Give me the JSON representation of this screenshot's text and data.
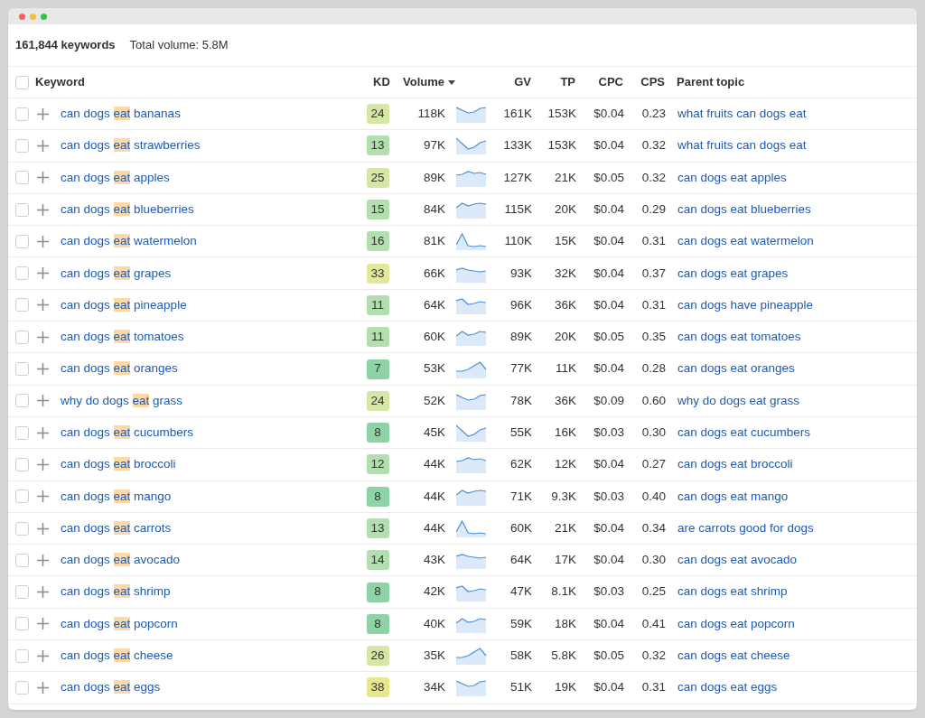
{
  "summary": {
    "count": "161,844 keywords",
    "total": "Total volume: 5.8M"
  },
  "select_all": {
    "checked": false
  },
  "columns": [
    {
      "label": "Keyword",
      "sorted": false
    },
    {
      "label": "KD",
      "sorted": false
    },
    {
      "label": "Volume",
      "sorted": true
    },
    {
      "label": "GV",
      "sorted": false
    },
    {
      "label": "TP",
      "sorted": false
    },
    {
      "label": "CPC",
      "sorted": false
    },
    {
      "label": "CPS",
      "sorted": false
    },
    {
      "label": "Parent topic",
      "sorted": false
    }
  ],
  "rows": [
    {
      "checked": false,
      "keyword": {
        "before": "can dogs ",
        "highlight": "eat",
        "after": " bananas"
      },
      "kd": "24",
      "color": "#d6e6a6",
      "volume": "118K",
      "gv": "161K",
      "tp": "153K",
      "cpc": "$0.04",
      "cps": "0.23",
      "parent": "what fruits can dogs eat"
    },
    {
      "checked": false,
      "keyword": {
        "before": "can dogs ",
        "highlight": "eat",
        "after": " strawberries"
      },
      "kd": "13",
      "color": "#b3dfb0",
      "volume": "97K",
      "gv": "133K",
      "tp": "153K",
      "cpc": "$0.04",
      "cps": "0.32",
      "parent": "what fruits can dogs eat"
    },
    {
      "checked": false,
      "keyword": {
        "before": "can dogs ",
        "highlight": "eat",
        "after": " apples"
      },
      "kd": "25",
      "color": "#d6e6a6",
      "volume": "89K",
      "gv": "127K",
      "tp": "21K",
      "cpc": "$0.05",
      "cps": "0.32",
      "parent": "can dogs eat apples"
    },
    {
      "checked": false,
      "keyword": {
        "before": "can dogs ",
        "highlight": "eat",
        "after": " blueberries"
      },
      "kd": "15",
      "color": "#b3dfb0",
      "volume": "84K",
      "gv": "115K",
      "tp": "20K",
      "cpc": "$0.04",
      "cps": "0.29",
      "parent": "can dogs eat blueberries"
    },
    {
      "checked": false,
      "keyword": {
        "before": "can dogs ",
        "highlight": "eat",
        "after": " watermelon"
      },
      "kd": "16",
      "color": "#b3dfb0",
      "volume": "81K",
      "gv": "110K",
      "tp": "15K",
      "cpc": "$0.04",
      "cps": "0.31",
      "parent": "can dogs eat watermelon"
    },
    {
      "checked": false,
      "keyword": {
        "before": "can dogs ",
        "highlight": "eat",
        "after": " grapes"
      },
      "kd": "33",
      "color": "#e3e89c",
      "volume": "66K",
      "gv": "93K",
      "tp": "32K",
      "cpc": "$0.04",
      "cps": "0.37",
      "parent": "can dogs eat grapes"
    },
    {
      "checked": false,
      "keyword": {
        "before": "can dogs ",
        "highlight": "eat",
        "after": " pineapple"
      },
      "kd": "11",
      "color": "#b3dfb0",
      "volume": "64K",
      "gv": "96K",
      "tp": "36K",
      "cpc": "$0.04",
      "cps": "0.31",
      "parent": "can dogs have pineapple"
    },
    {
      "checked": false,
      "keyword": {
        "before": "can dogs ",
        "highlight": "eat",
        "after": " tomatoes"
      },
      "kd": "11",
      "color": "#b3dfb0",
      "volume": "60K",
      "gv": "89K",
      "tp": "20K",
      "cpc": "$0.05",
      "cps": "0.35",
      "parent": "can dogs eat tomatoes"
    },
    {
      "checked": false,
      "keyword": {
        "before": "can dogs ",
        "highlight": "eat",
        "after": " oranges"
      },
      "kd": "7",
      "color": "#8ed3a6",
      "volume": "53K",
      "gv": "77K",
      "tp": "11K",
      "cpc": "$0.04",
      "cps": "0.28",
      "parent": "can dogs eat oranges"
    },
    {
      "checked": false,
      "keyword": {
        "before": "why do dogs ",
        "highlight": "eat",
        "after": " grass"
      },
      "kd": "24",
      "color": "#d6e6a6",
      "volume": "52K",
      "gv": "78K",
      "tp": "36K",
      "cpc": "$0.09",
      "cps": "0.60",
      "parent": "why do dogs eat grass"
    },
    {
      "checked": false,
      "keyword": {
        "before": "can dogs ",
        "highlight": "eat",
        "after": " cucumbers"
      },
      "kd": "8",
      "color": "#8ed3a6",
      "volume": "45K",
      "gv": "55K",
      "tp": "16K",
      "cpc": "$0.03",
      "cps": "0.30",
      "parent": "can dogs eat cucumbers"
    },
    {
      "checked": false,
      "keyword": {
        "before": "can dogs ",
        "highlight": "eat",
        "after": " broccoli"
      },
      "kd": "12",
      "color": "#b3dfb0",
      "volume": "44K",
      "gv": "62K",
      "tp": "12K",
      "cpc": "$0.04",
      "cps": "0.27",
      "parent": "can dogs eat broccoli"
    },
    {
      "checked": false,
      "keyword": {
        "before": "can dogs ",
        "highlight": "eat",
        "after": " mango"
      },
      "kd": "8",
      "color": "#8ed3a6",
      "volume": "44K",
      "gv": "71K",
      "tp": "9.3K",
      "cpc": "$0.03",
      "cps": "0.40",
      "parent": "can dogs eat mango"
    },
    {
      "checked": false,
      "keyword": {
        "before": "can dogs ",
        "highlight": "eat",
        "after": " carrots"
      },
      "kd": "13",
      "color": "#b3dfb0",
      "volume": "44K",
      "gv": "60K",
      "tp": "21K",
      "cpc": "$0.04",
      "cps": "0.34",
      "parent": "are carrots good for dogs"
    },
    {
      "checked": false,
      "keyword": {
        "before": "can dogs ",
        "highlight": "eat",
        "after": " avocado"
      },
      "kd": "14",
      "color": "#b3dfb0",
      "volume": "43K",
      "gv": "64K",
      "tp": "17K",
      "cpc": "$0.04",
      "cps": "0.30",
      "parent": "can dogs eat avocado"
    },
    {
      "checked": false,
      "keyword": {
        "before": "can dogs ",
        "highlight": "eat",
        "after": " shrimp"
      },
      "kd": "8",
      "color": "#8ed3a6",
      "volume": "42K",
      "gv": "47K",
      "tp": "8.1K",
      "cpc": "$0.03",
      "cps": "0.25",
      "parent": "can dogs eat shrimp"
    },
    {
      "checked": false,
      "keyword": {
        "before": "can dogs ",
        "highlight": "eat",
        "after": " popcorn"
      },
      "kd": "8",
      "color": "#8ed3a6",
      "volume": "40K",
      "gv": "59K",
      "tp": "18K",
      "cpc": "$0.04",
      "cps": "0.41",
      "parent": "can dogs eat popcorn"
    },
    {
      "checked": false,
      "keyword": {
        "before": "can dogs ",
        "highlight": "eat",
        "after": " cheese"
      },
      "kd": "26",
      "color": "#d6e6a6",
      "volume": "35K",
      "gv": "58K",
      "tp": "5.8K",
      "cpc": "$0.05",
      "cps": "0.32",
      "parent": "can dogs eat cheese"
    },
    {
      "checked": false,
      "keyword": {
        "before": "can dogs ",
        "highlight": "eat",
        "after": " eggs"
      },
      "kd": "38",
      "color": "#e6e68a",
      "volume": "34K",
      "gv": "51K",
      "tp": "19K",
      "cpc": "$0.04",
      "cps": "0.31",
      "parent": "can dogs eat eggs"
    }
  ]
}
